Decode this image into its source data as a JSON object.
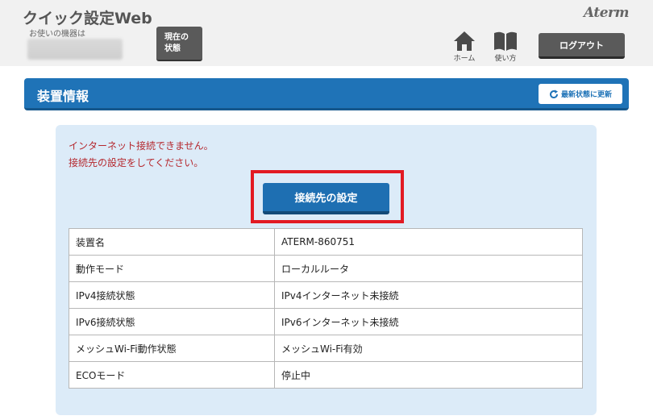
{
  "header": {
    "app_title": "クイック設定Web",
    "device_label": "お使いの機器は",
    "status_button": "現在の\n状態",
    "brand_logo": "Aterm",
    "home_label": "ホーム",
    "help_label": "使い方",
    "logout_label": "ログアウト"
  },
  "section": {
    "title": "装置情報",
    "refresh_label": "最新状態に更新"
  },
  "alert": {
    "line1": "インターネット接続できません。",
    "line2": "接続先の設定をしてください。"
  },
  "setup_button": "接続先の設定",
  "table": {
    "rows": [
      {
        "key": "装置名",
        "value": "ATERM-860751"
      },
      {
        "key": "動作モード",
        "value": "ローカルルータ"
      },
      {
        "key": "IPv4接続状態",
        "value": "IPv4インターネット未接続"
      },
      {
        "key": "IPv6接続状態",
        "value": "IPv6インターネット未接続"
      },
      {
        "key": "メッシュWi-Fi動作状態",
        "value": "メッシュWi-Fi有効"
      },
      {
        "key": "ECOモード",
        "value": "停止中"
      }
    ]
  },
  "colors": {
    "accent_blue": "#1f73b7",
    "alert_red": "#b5282e",
    "highlight_red": "#e21a23",
    "panel_bg": "#dcebf8"
  }
}
